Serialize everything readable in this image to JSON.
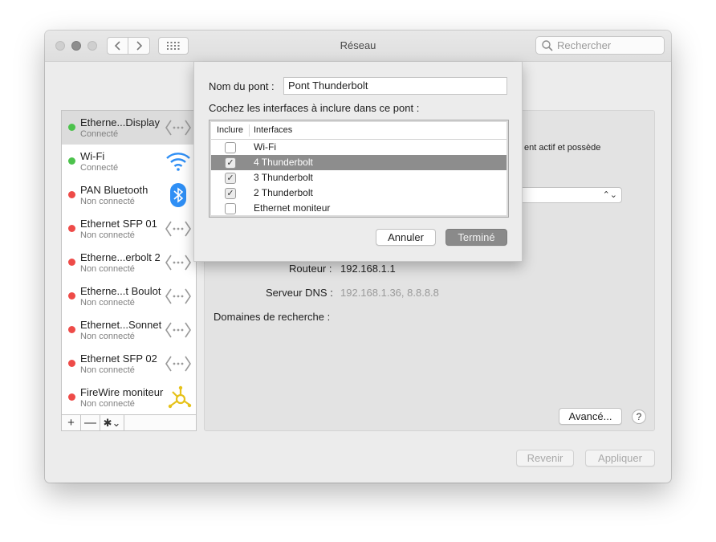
{
  "window": {
    "title": "Réseau"
  },
  "search": {
    "placeholder": "Rechercher"
  },
  "services": [
    {
      "name": "Etherne...Display",
      "status": "Connecté",
      "state": "green",
      "icon": "ethernet-arrows-icon"
    },
    {
      "name": "Wi-Fi",
      "status": "Connecté",
      "state": "green",
      "icon": "wifi-icon"
    },
    {
      "name": "PAN Bluetooth",
      "status": "Non connecté",
      "state": "red",
      "icon": "bluetooth-icon"
    },
    {
      "name": "Ethernet SFP 01",
      "status": "Non connecté",
      "state": "red",
      "icon": "ethernet-arrows-icon"
    },
    {
      "name": "Etherne...erbolt 2",
      "status": "Non connecté",
      "state": "red",
      "icon": "ethernet-arrows-icon"
    },
    {
      "name": "Etherne...t Boulot",
      "status": "Non connecté",
      "state": "red",
      "icon": "ethernet-arrows-icon"
    },
    {
      "name": "Ethernet...Sonnet",
      "status": "Non connecté",
      "state": "red",
      "icon": "ethernet-arrows-icon"
    },
    {
      "name": "Ethernet SFP 02",
      "status": "Non connecté",
      "state": "red",
      "icon": "ethernet-arrows-icon"
    },
    {
      "name": "FireWire moniteur",
      "status": "Non connecté",
      "state": "red",
      "icon": "firewire-icon"
    }
  ],
  "sidebar_controls": {
    "add": "+",
    "remove": "—",
    "gear": "✱⌄"
  },
  "detail": {
    "status_fragment": "ent actif et possède",
    "router_label": "Routeur :",
    "router_value": "192.168.1.1",
    "dns_label": "Serveur DNS :",
    "dns_value": "192.168.1.36, 8.8.8.8",
    "search_domains_label": "Domaines de recherche :",
    "advanced_button": "Avancé...",
    "help": "?"
  },
  "footer": {
    "revert": "Revenir",
    "apply": "Appliquer"
  },
  "sheet": {
    "name_label": "Nom du pont :",
    "name_value": "Pont Thunderbolt",
    "instruction": "Cochez les interfaces à inclure dans ce pont :",
    "col_include": "Inclure",
    "col_interfaces": "Interfaces",
    "rows": [
      {
        "label": "Wi-Fi",
        "checked": false,
        "selected": false
      },
      {
        "label": "4 Thunderbolt",
        "checked": true,
        "selected": true
      },
      {
        "label": "3 Thunderbolt",
        "checked": true,
        "selected": false
      },
      {
        "label": "2 Thunderbolt",
        "checked": true,
        "selected": false
      },
      {
        "label": "Ethernet moniteur",
        "checked": false,
        "selected": false
      }
    ],
    "cancel": "Annuler",
    "done": "Terminé"
  },
  "colors": {
    "connected": "#4cc24c",
    "disconnected": "#ee4b48",
    "selection": "#8d8d8d",
    "bluetooth": "#2f8ff5",
    "firewire": "#e6c21a"
  }
}
